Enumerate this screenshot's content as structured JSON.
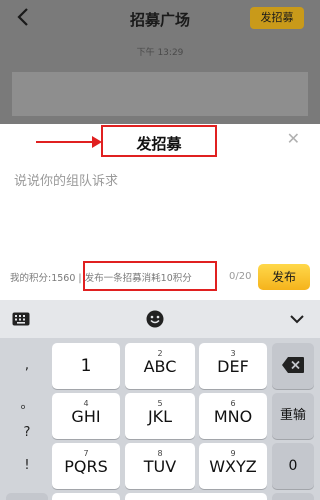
{
  "header": {
    "title": "招募广场",
    "publish_label": "发招募",
    "timestamp": "下午 13:29"
  },
  "sheet": {
    "title": "发招募",
    "placeholder": "说说你的组队诉求",
    "points_label": "我的积分:1560",
    "separator": "|",
    "cost_hint": "发布一条招募消耗10积分",
    "counter": "0/20",
    "submit_label": "发布"
  },
  "keyboard": {
    "punctuation": [
      ",",
      "。",
      "?",
      "!"
    ],
    "keys": [
      {
        "num": "",
        "letters": "1"
      },
      {
        "num": "2",
        "letters": "ABC"
      },
      {
        "num": "3",
        "letters": "DEF"
      },
      {
        "num": "4",
        "letters": "GHI"
      },
      {
        "num": "5",
        "letters": "JKL"
      },
      {
        "num": "6",
        "letters": "MNO"
      },
      {
        "num": "7",
        "letters": "PQRS"
      },
      {
        "num": "8",
        "letters": "TUV"
      },
      {
        "num": "9",
        "letters": "WXYZ"
      }
    ],
    "reenter_label": "重输",
    "zero_label": "0",
    "icons": {
      "keyboard": "keyboard-icon",
      "emoji": "emoji-icon",
      "collapse": "chevron-down-icon",
      "delete": "backspace-icon"
    }
  },
  "colors": {
    "accent": "#f5b31c",
    "annotation": "#e02020"
  }
}
